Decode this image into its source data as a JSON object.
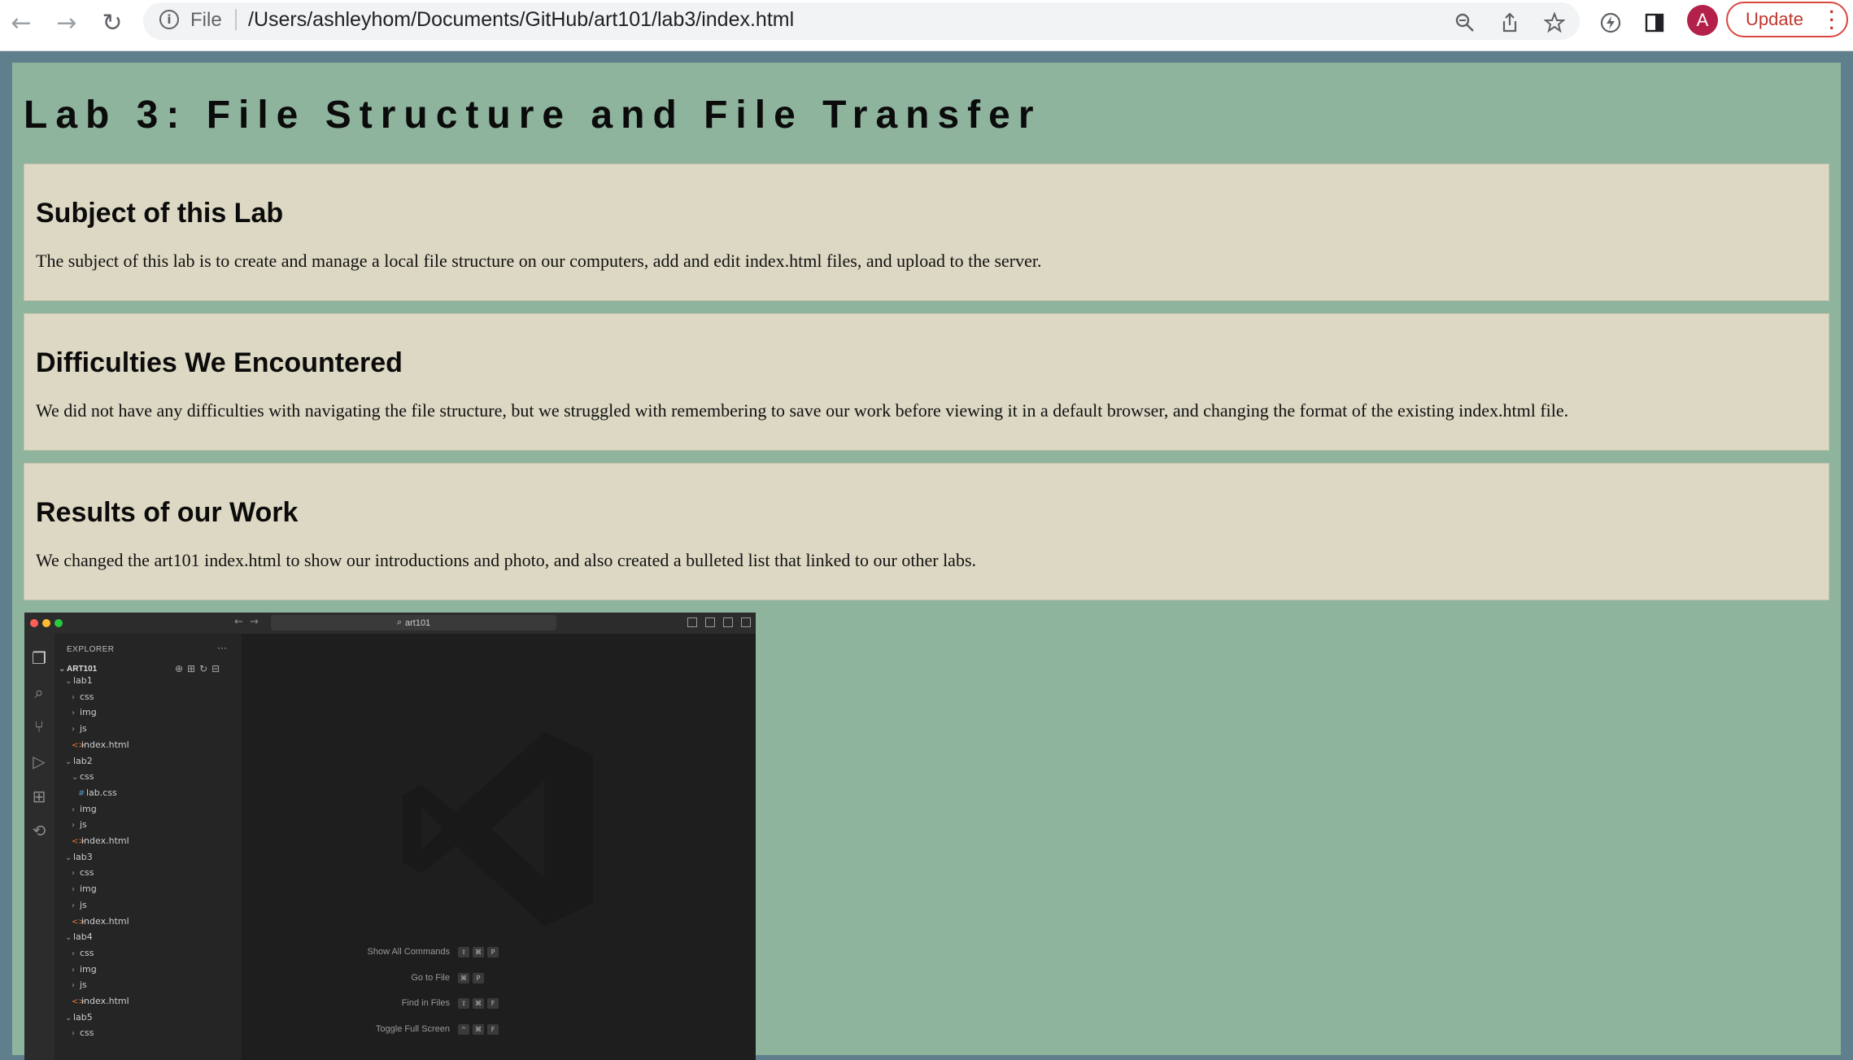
{
  "browser": {
    "back_icon": "←",
    "forward_icon": "→",
    "reload_icon": "↻",
    "file_label": "File",
    "url": "/Users/ashleyhom/Documents/GitHub/art101/lab3/index.html",
    "avatar_letter": "A",
    "update_label": "Update"
  },
  "page": {
    "title": "Lab 3: File Structure and File Transfer",
    "sections": [
      {
        "heading": "Subject of this Lab",
        "text": "The subject of this lab is to create and manage a local file structure on our computers, add and edit index.html files, and upload to the server."
      },
      {
        "heading": "Difficulties We Encountered",
        "text": "We did not have any difficulties with navigating the file structure, but we struggled with remembering to save our work before viewing it in a default browser, and changing the format of the existing index.html file."
      },
      {
        "heading": "Results of our Work",
        "text": "We changed the art101 index.html to show our introductions and photo, and also created a bulleted list that linked to our other labs."
      }
    ]
  },
  "screenshot": {
    "search": "art101",
    "explorer_header": "EXPLORER",
    "root": "ART101",
    "tree": [
      {
        "label": "lab1",
        "depth": 0,
        "kind": "folder-open"
      },
      {
        "label": "css",
        "depth": 1,
        "kind": "folder"
      },
      {
        "label": "img",
        "depth": 1,
        "kind": "folder"
      },
      {
        "label": "js",
        "depth": 1,
        "kind": "folder"
      },
      {
        "label": "index.html",
        "depth": 1,
        "kind": "html"
      },
      {
        "label": "lab2",
        "depth": 0,
        "kind": "folder-open"
      },
      {
        "label": "css",
        "depth": 1,
        "kind": "folder-open"
      },
      {
        "label": "lab.css",
        "depth": 2,
        "kind": "css"
      },
      {
        "label": "img",
        "depth": 1,
        "kind": "folder"
      },
      {
        "label": "js",
        "depth": 1,
        "kind": "folder"
      },
      {
        "label": "index.html",
        "depth": 1,
        "kind": "html"
      },
      {
        "label": "lab3",
        "depth": 0,
        "kind": "folder-open"
      },
      {
        "label": "css",
        "depth": 1,
        "kind": "folder"
      },
      {
        "label": "img",
        "depth": 1,
        "kind": "folder"
      },
      {
        "label": "js",
        "depth": 1,
        "kind": "folder"
      },
      {
        "label": "index.html",
        "depth": 1,
        "kind": "html"
      },
      {
        "label": "lab4",
        "depth": 0,
        "kind": "folder-open"
      },
      {
        "label": "css",
        "depth": 1,
        "kind": "folder"
      },
      {
        "label": "img",
        "depth": 1,
        "kind": "folder"
      },
      {
        "label": "js",
        "depth": 1,
        "kind": "folder"
      },
      {
        "label": "index.html",
        "depth": 1,
        "kind": "html"
      },
      {
        "label": "lab5",
        "depth": 0,
        "kind": "folder-open"
      },
      {
        "label": "css",
        "depth": 1,
        "kind": "folder"
      }
    ],
    "shortcuts": [
      {
        "label": "Show All Commands",
        "keys": [
          "⇧",
          "⌘",
          "P"
        ]
      },
      {
        "label": "Go to File",
        "keys": [
          "⌘",
          "P"
        ]
      },
      {
        "label": "Find in Files",
        "keys": [
          "⇧",
          "⌘",
          "F"
        ]
      },
      {
        "label": "Toggle Full Screen",
        "keys": [
          "^",
          "⌘",
          "F"
        ]
      }
    ]
  },
  "colors": {
    "page_bg": "#8eb49e",
    "card_bg": "#dcd8c3",
    "update_accent": "#d9473f",
    "avatar": "#b3214b"
  }
}
